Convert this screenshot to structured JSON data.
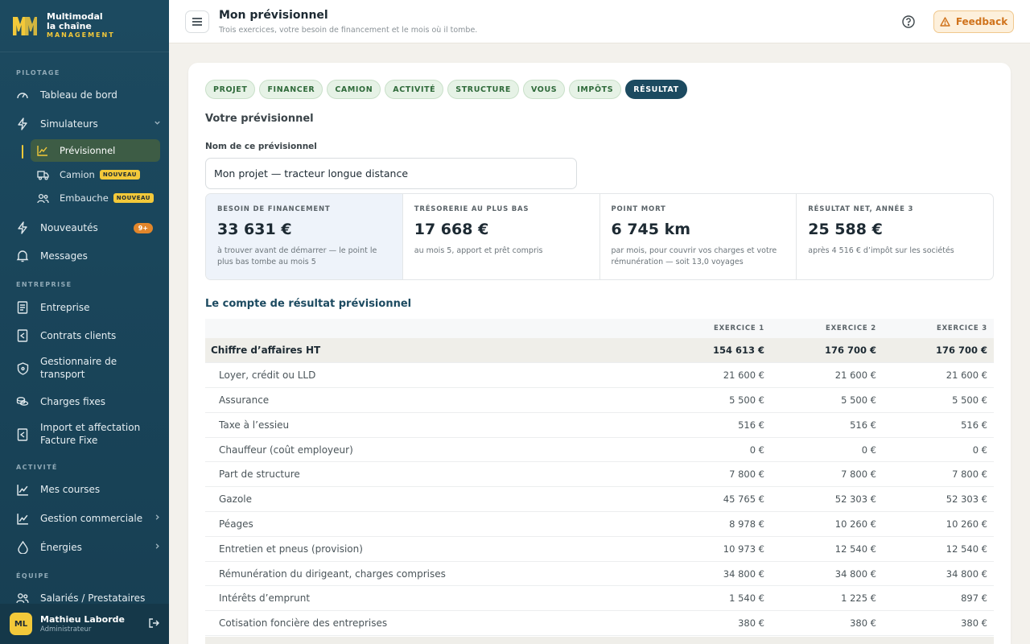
{
  "brand": {
    "line1": "Multimodal",
    "line2": "la chaîne",
    "line3": "MANAGEMENT",
    "logo_letters": "MM",
    "accent": "#f3c93a"
  },
  "sidebar": {
    "sections": {
      "pilotage": "PILOTAGE",
      "entreprise": "ENTREPRISE",
      "activite": "ACTIVITÉ",
      "equipe": "ÉQUIPE"
    },
    "items": {
      "tableau": "Tableau de bord",
      "simulateurs": "Simulateurs",
      "previsionnel": "Prévisionnel",
      "camion": "Camion",
      "embauche": "Embauche",
      "nouveau": "NOUVEAU",
      "nouveautes": "Nouveautés",
      "nouveautes_badge": "9+",
      "messages": "Messages",
      "entreprise": "Entreprise",
      "contrats": "Contrats clients",
      "gestionnaire_1": "Gestionnaire de",
      "gestionnaire_2": "transport",
      "charges": "Charges fixes",
      "import_1": "Import et affectation",
      "import_2": "Facture Fixe",
      "courses": "Mes courses",
      "commerciale": "Gestion commerciale",
      "energies": "Énergies",
      "salaries": "Salariés / Prestataires"
    },
    "user": {
      "initials": "ML",
      "name": "Mathieu Laborde",
      "role": "Administrateur"
    }
  },
  "header": {
    "title": "Mon prévisionnel",
    "subtitle": "Trois exercices, votre besoin de financement et le mois où il tombe.",
    "feedback": "Feedback"
  },
  "tabs": [
    "PROJET",
    "FINANCER",
    "CAMION",
    "ACTIVITÉ",
    "STRUCTURE",
    "VOUS",
    "IMPÔTS",
    "RÉSULTAT"
  ],
  "active_tab": "RÉSULTAT",
  "form": {
    "section_title": "Votre prévisionnel",
    "name_label": "Nom de ce prévisionnel",
    "name_value": "Mon projet — tracteur longue distance"
  },
  "kpis": [
    {
      "label": "BESOIN DE FINANCEMENT",
      "value": "33 631 €",
      "desc": "à trouver avant de démarrer — le point le plus bas tombe au mois 5"
    },
    {
      "label": "TRÉSORERIE AU PLUS BAS",
      "value": "17 668 €",
      "desc": "au mois 5, apport et prêt compris"
    },
    {
      "label": "POINT MORT",
      "value": "6 745 km",
      "desc": "par mois, pour couvrir vos charges et votre rémunération — soit 13,0 voyages"
    },
    {
      "label": "RÉSULTAT NET, ANNÉE 3",
      "value": "25 588 €",
      "desc": "après 4 516 € d’impôt sur les sociétés"
    }
  ],
  "table": {
    "title": "Le compte de résultat prévisionnel",
    "headers": [
      "",
      "EXERCICE 1",
      "EXERCICE 2",
      "EXERCICE 3"
    ],
    "rows": [
      {
        "label": "Chiffre d’affaires HT",
        "values": [
          "154 613 €",
          "176 700 €",
          "176 700 €"
        ],
        "total": true
      },
      {
        "label": "Loyer, crédit ou LLD",
        "values": [
          "21 600 €",
          "21 600 €",
          "21 600 €"
        ]
      },
      {
        "label": "Assurance",
        "values": [
          "5 500 €",
          "5 500 €",
          "5 500 €"
        ]
      },
      {
        "label": "Taxe à l’essieu",
        "values": [
          "516 €",
          "516 €",
          "516 €"
        ]
      },
      {
        "label": "Chauffeur (coût employeur)",
        "values": [
          "0 €",
          "0 €",
          "0 €"
        ]
      },
      {
        "label": "Part de structure",
        "values": [
          "7 800 €",
          "7 800 €",
          "7 800 €"
        ]
      },
      {
        "label": "Gazole",
        "values": [
          "45 765 €",
          "52 303 €",
          "52 303 €"
        ]
      },
      {
        "label": "Péages",
        "values": [
          "8 978 €",
          "10 260 €",
          "10 260 €"
        ]
      },
      {
        "label": "Entretien et pneus (provision)",
        "values": [
          "10 973 €",
          "12 540 €",
          "12 540 €"
        ]
      },
      {
        "label": "Rémunération du dirigeant, charges comprises",
        "values": [
          "34 800 €",
          "34 800 €",
          "34 800 €"
        ]
      },
      {
        "label": "Intérêts d’emprunt",
        "values": [
          "1 540 €",
          "1 225 €",
          "897 €"
        ]
      },
      {
        "label": "Cotisation foncière des entreprises",
        "values": [
          "380 €",
          "380 €",
          "380 €"
        ]
      }
    ]
  }
}
